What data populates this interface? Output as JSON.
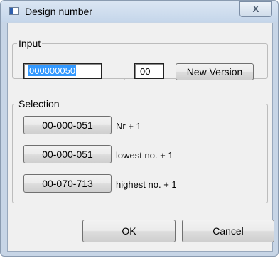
{
  "window": {
    "title": "Design number",
    "close_symbol": "X"
  },
  "input_group": {
    "label": "Input",
    "number_value": "000000050",
    "separator": ".",
    "version_value": "00",
    "new_version_label": "New Version"
  },
  "selection_group": {
    "label": "Selection",
    "rows": [
      {
        "button": "00-000-051",
        "label": "Nr + 1"
      },
      {
        "button": "00-000-051",
        "label": "lowest no. + 1"
      },
      {
        "button": "00-070-713",
        "label": "highest no. + 1"
      }
    ]
  },
  "footer": {
    "ok_label": "OK",
    "cancel_label": "Cancel"
  }
}
